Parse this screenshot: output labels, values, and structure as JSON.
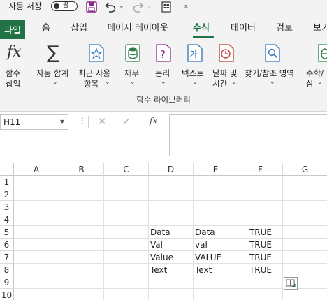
{
  "title_bar": {
    "autosave_label": "자동 저장",
    "autosave_state": "끔"
  },
  "tabs": [
    {
      "label": "파일"
    },
    {
      "label": "홈"
    },
    {
      "label": "삽입"
    },
    {
      "label": "페이지 레이아웃"
    },
    {
      "label": "수식"
    },
    {
      "label": "데이터"
    },
    {
      "label": "검토"
    },
    {
      "label": "보기"
    }
  ],
  "ribbon": {
    "insert_function": {
      "line1": "함수",
      "line2": "삽입"
    },
    "autosum": {
      "label": "자동 합계"
    },
    "recent": {
      "line1": "최근 사용",
      "line2": "항목"
    },
    "financial": {
      "label": "재무"
    },
    "logical": {
      "label": "논리"
    },
    "text": {
      "label": "텍스트"
    },
    "datetime": {
      "line1": "날짜 및",
      "line2": "시간"
    },
    "lookup": {
      "label": "찾기/참조 영역"
    },
    "math": {
      "label": "수학/삼"
    },
    "group_label": "함수 라이브러리"
  },
  "formula_bar": {
    "name_box": "H11",
    "fx_label": "fx",
    "value": ""
  },
  "grid": {
    "columns": [
      "A",
      "B",
      "C",
      "D",
      "E",
      "F",
      "G"
    ],
    "rows": [
      "1",
      "2",
      "3",
      "4",
      "5",
      "6",
      "7",
      "8",
      "9",
      "10"
    ],
    "cells": {
      "D5": "Data",
      "E5": "Data",
      "F5": "TRUE",
      "D6": "Val",
      "E6": "val",
      "F6": "TRUE",
      "D7": "Value",
      "E7": "VALUE",
      "F7": "TRUE",
      "D8": "Text",
      "E8": "Text",
      "F8": "TRUE"
    }
  },
  "colors": {
    "accent": "#217346",
    "ribbon_bg": "#f3f3f3"
  }
}
